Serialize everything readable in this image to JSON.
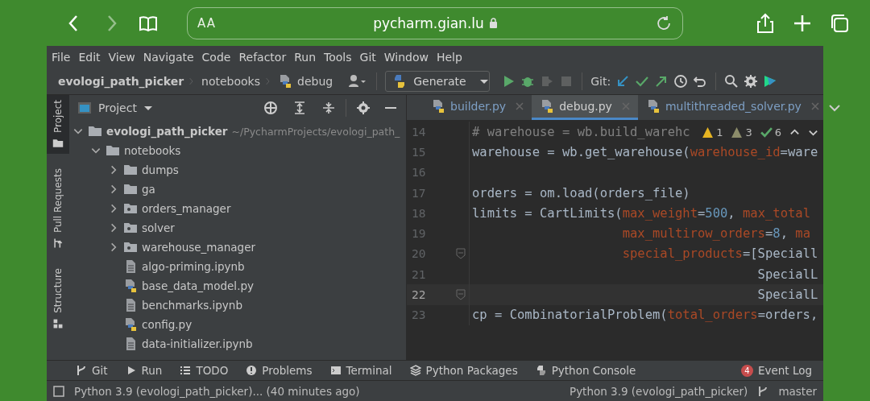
{
  "browser": {
    "text_size": "AA",
    "url": "pycharm.gian.lu",
    "forward_disabled": true
  },
  "menu": [
    "File",
    "Edit",
    "View",
    "Navigate",
    "Code",
    "Refactor",
    "Run",
    "Tools",
    "Git",
    "Window",
    "Help"
  ],
  "breadcrumbs": [
    "evologi_path_picker",
    "notebooks",
    "debug"
  ],
  "run_config": "Generate",
  "git_label": "Git:",
  "side_tabs": [
    {
      "label": "Project",
      "selected": true,
      "kind": "folder"
    },
    {
      "label": "Pull Requests",
      "selected": false,
      "kind": "pull"
    },
    {
      "label": "Structure",
      "selected": false,
      "kind": "structure"
    }
  ],
  "project_panel": {
    "title": "Project",
    "tree": [
      {
        "name": "evologi_path_picker",
        "path": "~/PycharmProjects/evologi_path_",
        "kind": "folder",
        "expanded": true,
        "children": [
          {
            "name": "notebooks",
            "kind": "folder",
            "expanded": true,
            "children": [
              {
                "name": "dumps",
                "kind": "folder",
                "expanded": false
              },
              {
                "name": "ga",
                "kind": "folder",
                "expanded": false
              },
              {
                "name": "orders_manager",
                "kind": "package",
                "expanded": false
              },
              {
                "name": "solver",
                "kind": "package",
                "expanded": false
              },
              {
                "name": "warehouse_manager",
                "kind": "package",
                "expanded": false
              },
              {
                "name": "algo-priming.ipynb",
                "kind": "notebook"
              },
              {
                "name": "base_data_model.py",
                "kind": "python"
              },
              {
                "name": "benchmarks.ipynb",
                "kind": "notebook"
              },
              {
                "name": "config.py",
                "kind": "python"
              },
              {
                "name": "data-initializer.ipynb",
                "kind": "notebook"
              }
            ]
          }
        ]
      }
    ]
  },
  "editor": {
    "tabs": [
      {
        "label": "builder.py",
        "selected": false
      },
      {
        "label": "debug.py",
        "selected": true
      },
      {
        "label": "multithreaded_solver.py",
        "selected": false
      }
    ],
    "inspections": [
      {
        "kind": "warning",
        "count": "1"
      },
      {
        "kind": "weak",
        "count": "3"
      },
      {
        "kind": "typo",
        "count": "6"
      }
    ],
    "lines": [
      {
        "number": "14",
        "current": false,
        "fold": false,
        "tokens": [
          {
            "kind": "comment",
            "text": "# warehouse = wb.build_warehc"
          }
        ]
      },
      {
        "number": "15",
        "current": false,
        "fold": false,
        "tokens": [
          {
            "kind": "plain",
            "text": "warehouse = wb.get_warehouse("
          },
          {
            "kind": "param",
            "text": "warehouse_id"
          },
          {
            "kind": "plain",
            "text": "=ware"
          }
        ]
      },
      {
        "number": "16",
        "current": false,
        "fold": false
      },
      {
        "number": "17",
        "current": false,
        "fold": false,
        "tokens": [
          {
            "kind": "plain",
            "text": "orders = om.load(orders_file)"
          }
        ]
      },
      {
        "number": "18",
        "current": false,
        "fold": false,
        "tokens": [
          {
            "kind": "plain",
            "text": "limits = CartLimits("
          },
          {
            "kind": "param",
            "text": "max_weight"
          },
          {
            "kind": "plain",
            "text": "="
          },
          {
            "kind": "number",
            "text": "500"
          },
          {
            "kind": "plain",
            "text": ", "
          },
          {
            "kind": "param",
            "text": "max_total"
          }
        ]
      },
      {
        "number": "19",
        "current": false,
        "fold": false,
        "tokens": [
          {
            "kind": "param",
            "text": "                    max_multirow_orders"
          },
          {
            "kind": "plain",
            "text": "="
          },
          {
            "kind": "number",
            "text": "8"
          },
          {
            "kind": "plain",
            "text": ", "
          },
          {
            "kind": "param",
            "text": "ma"
          }
        ]
      },
      {
        "number": "20",
        "current": false,
        "fold": true,
        "tokens": [
          {
            "kind": "param",
            "text": "                    special_products"
          },
          {
            "kind": "plain",
            "text": "=[Speciall"
          }
        ]
      },
      {
        "number": "21",
        "current": false,
        "fold": false,
        "tokens": [
          {
            "kind": "plain",
            "text": "                                      SpecialL"
          }
        ]
      },
      {
        "number": "22",
        "current": true,
        "fold": true,
        "tokens": [
          {
            "kind": "plain",
            "text": "                                      SpecialL"
          }
        ]
      },
      {
        "number": "23",
        "current": false,
        "fold": false,
        "tokens": [
          {
            "kind": "plain",
            "text": "cp = CombinatorialProblem("
          },
          {
            "kind": "param",
            "text": "total_orders"
          },
          {
            "kind": "plain",
            "text": "=orders,"
          }
        ]
      }
    ]
  },
  "tool_buttons": [
    {
      "label": "Git",
      "kind": "git"
    },
    {
      "label": "Run",
      "kind": "run"
    },
    {
      "label": "TODO",
      "kind": "todo"
    },
    {
      "label": "Problems",
      "kind": "problems"
    },
    {
      "label": "Terminal",
      "kind": "terminal"
    },
    {
      "label": "Python Packages",
      "kind": "packages"
    },
    {
      "label": "Python Console",
      "kind": "console"
    }
  ],
  "event_log": {
    "label": "Event Log",
    "badge": "4"
  },
  "status_bar": {
    "message": "Python 3.9 (evologi_path_picker)... (40 minutes ago)",
    "interpreter": "Python 3.9 (evologi_path_picker)",
    "branch": "master"
  }
}
